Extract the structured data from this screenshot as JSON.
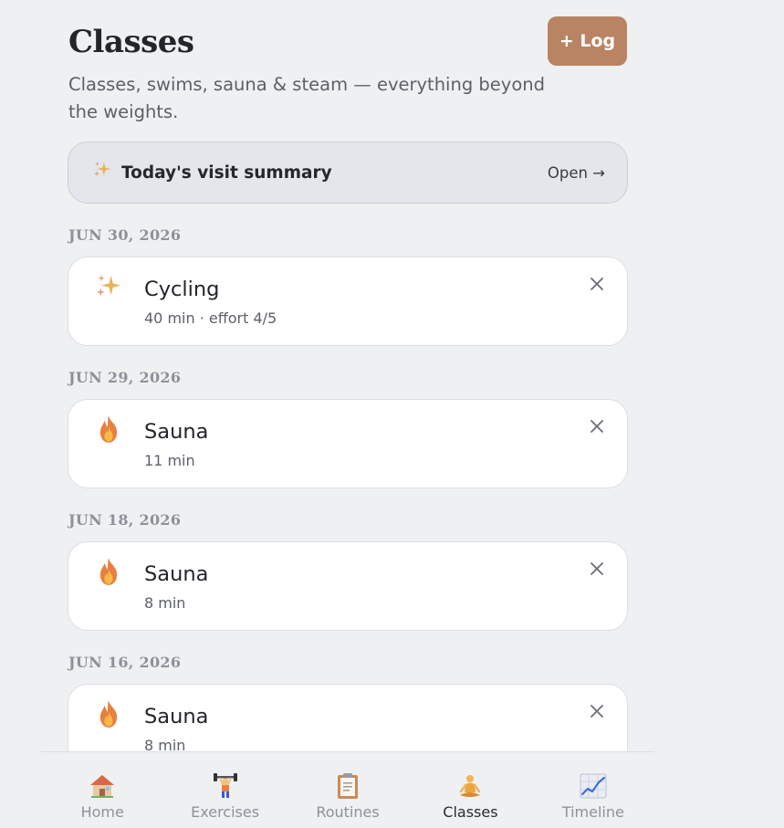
{
  "header": {
    "title": "Classes",
    "subtitle": "Classes, swims, sauna & steam — everything beyond the weights.",
    "log_button": "+ Log"
  },
  "summary": {
    "icon": "sparkles-icon",
    "label": "Today's visit summary",
    "action": "Open →"
  },
  "groups": [
    {
      "date": "JUN 30, 2026",
      "entry": {
        "icon": "sparkles-icon",
        "name": "Cycling",
        "meta": "40 min · effort 4/5"
      }
    },
    {
      "date": "JUN 29, 2026",
      "entry": {
        "icon": "fire-icon",
        "name": "Sauna",
        "meta": "11 min"
      }
    },
    {
      "date": "JUN 18, 2026",
      "entry": {
        "icon": "fire-icon",
        "name": "Sauna",
        "meta": "8 min"
      }
    },
    {
      "date": "JUN 16, 2026",
      "entry": {
        "icon": "fire-icon",
        "name": "Sauna",
        "meta": "8 min"
      }
    }
  ],
  "nav": {
    "items": [
      {
        "label": "Home",
        "icon": "house-icon"
      },
      {
        "label": "Exercises",
        "icon": "weightlifter-icon"
      },
      {
        "label": "Routines",
        "icon": "clipboard-icon"
      },
      {
        "label": "Classes",
        "icon": "meditation-icon",
        "active": true
      },
      {
        "label": "Timeline",
        "icon": "chart-icon"
      }
    ]
  },
  "colors": {
    "background": "#eff0f2",
    "accent": "#b98463",
    "card": "#ffffff"
  }
}
